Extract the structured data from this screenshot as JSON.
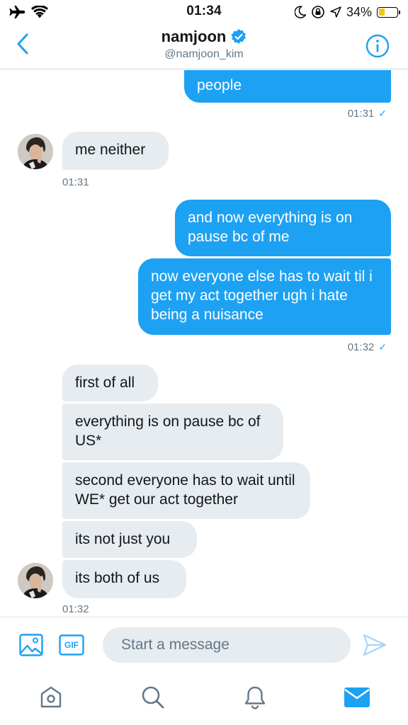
{
  "status_bar": {
    "time": "01:34",
    "battery_percent": "34%"
  },
  "header": {
    "name": "namjoon",
    "handle": "@namjoon_kim"
  },
  "messages": {
    "out_1": "people",
    "out_1_time": "01:31",
    "in_1": "me neither",
    "in_1_time": "01:31",
    "out_2": "and now everything is on pause bc of me",
    "out_3": "now everyone else has to wait til i get my act together ugh i hate being a nuisance",
    "out_3_time": "01:32",
    "in_2": "first of all",
    "in_3": "everything is on pause bc of US*",
    "in_4": "second everyone has to wait until WE* get our act together",
    "in_5": "its not just you",
    "in_6": "its both of us",
    "in_6_time": "01:32"
  },
  "composer": {
    "placeholder": "Start a message",
    "gif_label": "GIF"
  },
  "icons": {
    "back": "chevron-left-icon",
    "info": "info-icon",
    "verified": "verified-badge-icon",
    "image": "image-icon",
    "gif": "gif-icon",
    "send": "send-icon",
    "home": "home-icon",
    "search": "search-icon",
    "notifications": "bell-icon",
    "messages": "mail-icon"
  },
  "colors": {
    "accent": "#1da1f2",
    "incoming_bubble": "#e6ecf0",
    "muted_text": "#657786"
  }
}
